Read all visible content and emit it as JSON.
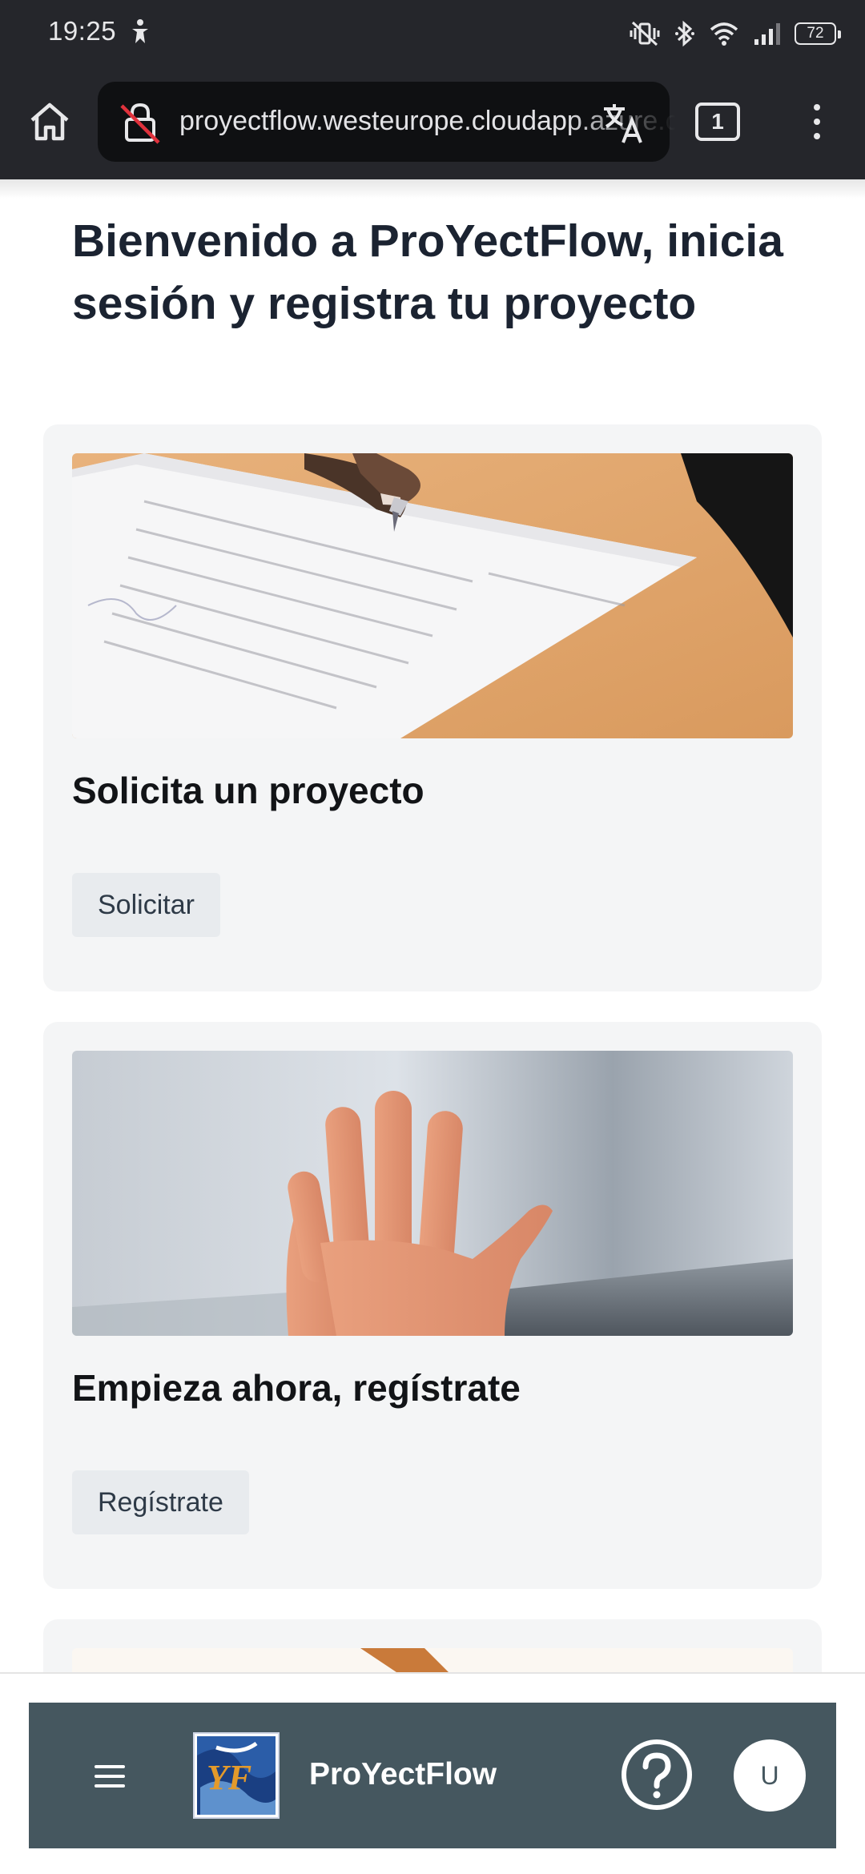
{
  "status_bar": {
    "time": "19:25",
    "battery_level": "72",
    "icons": [
      "accessibility-icon",
      "vibrate-icon",
      "bluetooth-icon",
      "wifi-icon",
      "signal-icon",
      "battery-icon"
    ]
  },
  "browser": {
    "url": "proyectflow.westeurope.cloudapp.azure.com",
    "tab_count": "1",
    "icons": [
      "home-icon",
      "not-secure-icon",
      "translate-icon",
      "tabs-icon",
      "more-menu-icon"
    ]
  },
  "page": {
    "title": "Bienvenido a ProYectFlow, inicia sesión y registra tu proyecto"
  },
  "cards": [
    {
      "title": "Solicita un proyecto",
      "button": "Solicitar"
    },
    {
      "title": "Empieza ahora, regístrate",
      "button": "Regístrate"
    }
  ],
  "app_bar": {
    "app_name": "ProYectFlow",
    "avatar_initial": "U",
    "icons": [
      "menu-icon",
      "logo-icon",
      "help-icon",
      "avatar"
    ]
  },
  "colors": {
    "chrome": "#25262b",
    "title": "#1b2331",
    "card_bg": "#f4f5f6",
    "button_bg": "#e8ebee",
    "app_bar": "#45575f"
  }
}
